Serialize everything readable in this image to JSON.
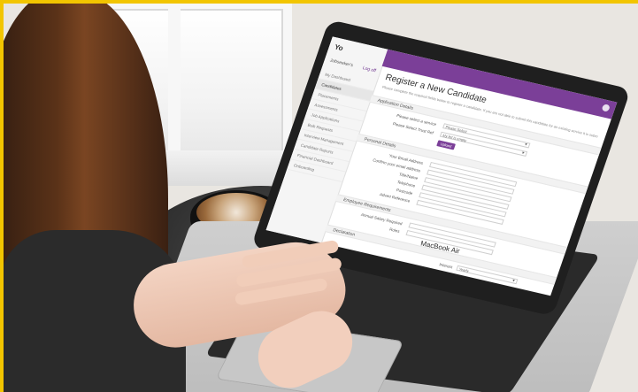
{
  "laptop_model_label": "MacBook Air",
  "app": {
    "logo_text": "Yo",
    "sidebar": {
      "top_left": "Jobseeker's",
      "logout": "Log off",
      "items": [
        "My Dashboard",
        "Candidates",
        "Placements",
        "Assessments",
        "Job Applications",
        "Bulk Requests",
        "Interview Management",
        "Candidate Reports",
        "Financial Dashboard",
        "Onboarding"
      ],
      "active_index": 1
    },
    "page": {
      "title": "Register a New Candidate",
      "help_text": "Please complete the required fields below to register a candidate. If you are not able to submit this candidate for an existing service it is submitted.",
      "sections": {
        "application_details": "Application Details",
        "personal_details": "Personal Details",
        "employment_requirements": "Employee Requirements",
        "declaration": "Declaration"
      },
      "fields": {
        "select_a_service_label": "Please select a service",
        "select_a_service_value": "Please Select",
        "select_from_list_label": "Please Select Trust Ref",
        "select_from_list_value": "My list is empty",
        "upload_button": "Upload",
        "first_email_label": "Your Email Address",
        "confirm_email_label": "Confirm your email address",
        "title_label": "Title/Name",
        "telephone_label": "Telephone",
        "postcode_label": "Postcode",
        "advert_label": "Advert Reference",
        "annual_salary_label": "Annual Salary Required",
        "roles_label": "Roles",
        "interest_label": "Interest",
        "interest_value": "Yearly"
      }
    }
  },
  "colors": {
    "header_purple": "#7b3f98",
    "accent_yellow": "#f2c500"
  }
}
